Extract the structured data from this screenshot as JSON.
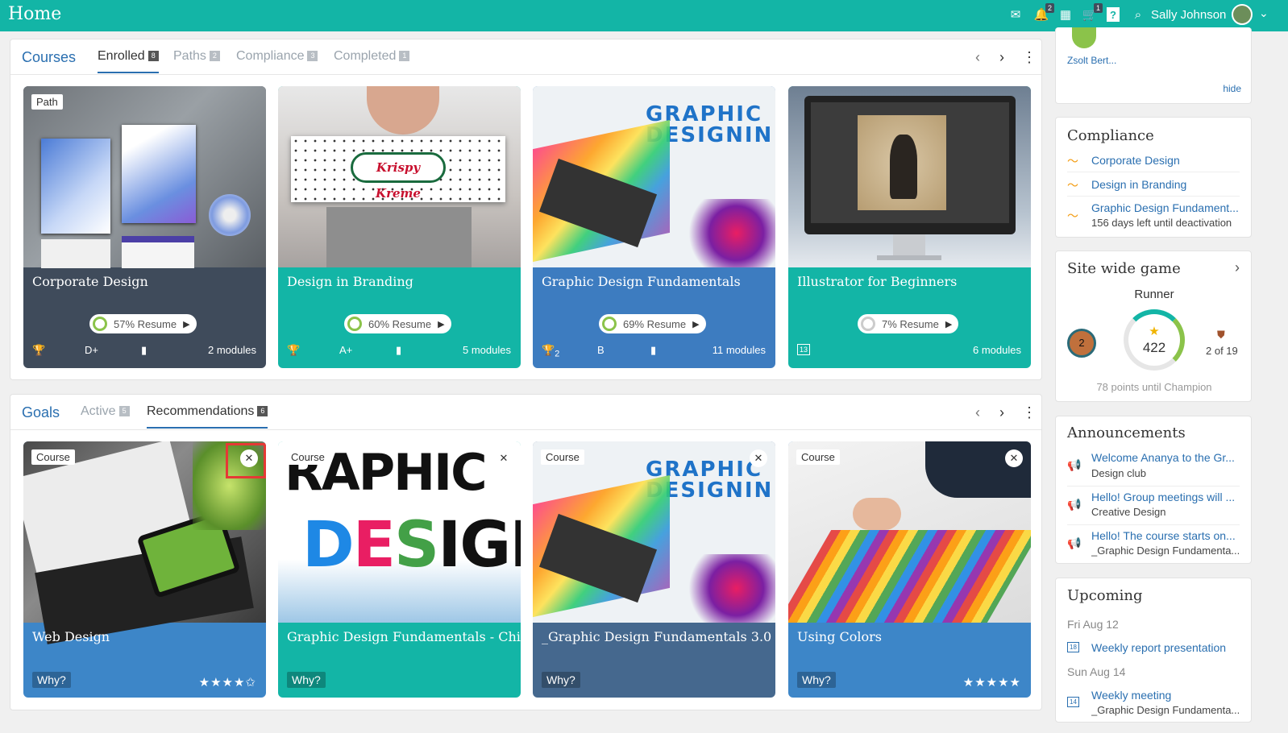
{
  "topbar": {
    "title": "Home",
    "user": "Sally Johnson",
    "notif_badge": "2",
    "cart_badge": "1"
  },
  "courses_panel": {
    "tabs": [
      {
        "label": "Courses"
      },
      {
        "label": "Enrolled",
        "count": "8"
      },
      {
        "label": "Paths",
        "count": "2"
      },
      {
        "label": "Compliance",
        "count": "3"
      },
      {
        "label": "Completed",
        "count": "1"
      }
    ],
    "cards": [
      {
        "tag": "Path",
        "title": "Corporate Design",
        "progress": "57%",
        "resume": "Resume",
        "grade": "D+",
        "modules": "2 modules",
        "color": "#3f4b5b",
        "image": "stationery-mockup"
      },
      {
        "title": "Design in Branding",
        "progress": "60%",
        "resume": "Resume",
        "grade": "A+",
        "modules": "5 modules",
        "color": "#13b5a6",
        "image": "krispy-kreme-box"
      },
      {
        "title": "Graphic Design Fundamentals",
        "progress": "69%",
        "resume": "Resume",
        "grade": "B",
        "trophy_count": "2",
        "modules": "11 modules",
        "color": "#3d7cc0",
        "image": "graphic-designing-banner"
      },
      {
        "title": "Illustrator for Beginners",
        "progress": "7%",
        "resume": "Resume",
        "modules": "6 modules",
        "badge": "13",
        "color": "#13b5a6",
        "image": "imac-illustrator"
      }
    ]
  },
  "goals_panel": {
    "tabs": [
      {
        "label": "Goals"
      },
      {
        "label": "Active",
        "count": "5"
      },
      {
        "label": "Recommendations",
        "count": "6"
      }
    ],
    "cards": [
      {
        "tag": "Course",
        "title": "Web Design",
        "why": "Why?",
        "stars": "★★★★✩",
        "color": "#3d86c8",
        "image": "laptop-web-design"
      },
      {
        "tag": "Course",
        "title": "Graphic Design Fundamentals - Child",
        "why": "Why?",
        "color": "#13b5a6",
        "image": "graphic-design-letters"
      },
      {
        "tag": "Course",
        "title": "_Graphic Design Fundamentals 3.0",
        "why": "Why?",
        "color": "#45688e",
        "image": "graphic-designing-banner"
      },
      {
        "tag": "Course",
        "title": "Using Colors",
        "why": "Why?",
        "stars": "★★★★★",
        "color": "#3d86c8",
        "image": "color-swatches"
      }
    ]
  },
  "sidebar": {
    "top": {
      "name": "Zsolt Bert...",
      "hide": "hide"
    },
    "compliance": {
      "title": "Compliance",
      "items": [
        {
          "label": "Corporate Design"
        },
        {
          "label": "Design in Branding"
        },
        {
          "label": "Graphic Design Fundament...",
          "sub": "156 days left until deactivation"
        }
      ]
    },
    "game": {
      "title": "Site wide game",
      "level": "Runner",
      "rank": "2",
      "points": "422",
      "position": "2 of 19",
      "footer": "78 points until Champion"
    },
    "announcements": {
      "title": "Announcements",
      "items": [
        {
          "title": "Welcome Ananya to the Gr...",
          "sub": "Design club"
        },
        {
          "title": "Hello! Group meetings will ...",
          "sub": "Creative Design"
        },
        {
          "title": "Hello! The course starts on...",
          "sub": "_Graphic Design Fundamenta..."
        }
      ]
    },
    "upcoming": {
      "title": "Upcoming",
      "groups": [
        {
          "date": "Fri Aug 12",
          "event": "Weekly report presentation",
          "icon_text": "18"
        },
        {
          "date": "Sun Aug 14",
          "event": "Weekly meeting",
          "sub": "_Graphic Design Fundamenta...",
          "icon_text": "14"
        }
      ]
    }
  }
}
